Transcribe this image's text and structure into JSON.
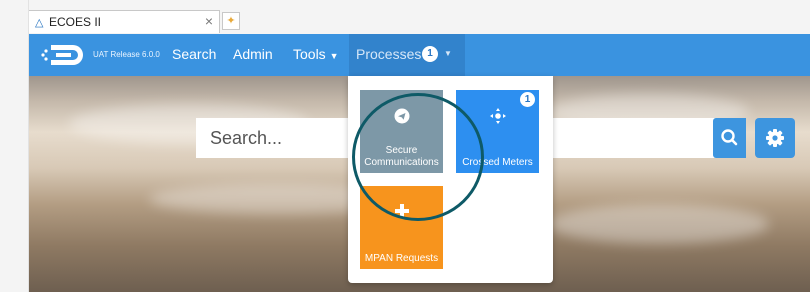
{
  "browser": {
    "tab_title": "ECOES II",
    "close_glyph": "×"
  },
  "navbar": {
    "release": "UAT Release 6.0.0",
    "items": [
      {
        "label": "Search"
      },
      {
        "label": "Admin"
      },
      {
        "label": "Tools"
      },
      {
        "label": "Processes",
        "badge": "1"
      }
    ],
    "color": "#3a93e0"
  },
  "search": {
    "placeholder": "Search..."
  },
  "processes_menu": {
    "tiles": [
      {
        "label": "Secure Communications",
        "icon": "paper-plane-icon",
        "color": "#7d98a7"
      },
      {
        "label": "Crossed Meters",
        "icon": "crosshair-icon",
        "color": "#2d8ff0",
        "badge": "1"
      },
      {
        "label": "MPAN Requests",
        "icon": "plus-icon",
        "color": "#f7941d"
      }
    ]
  }
}
